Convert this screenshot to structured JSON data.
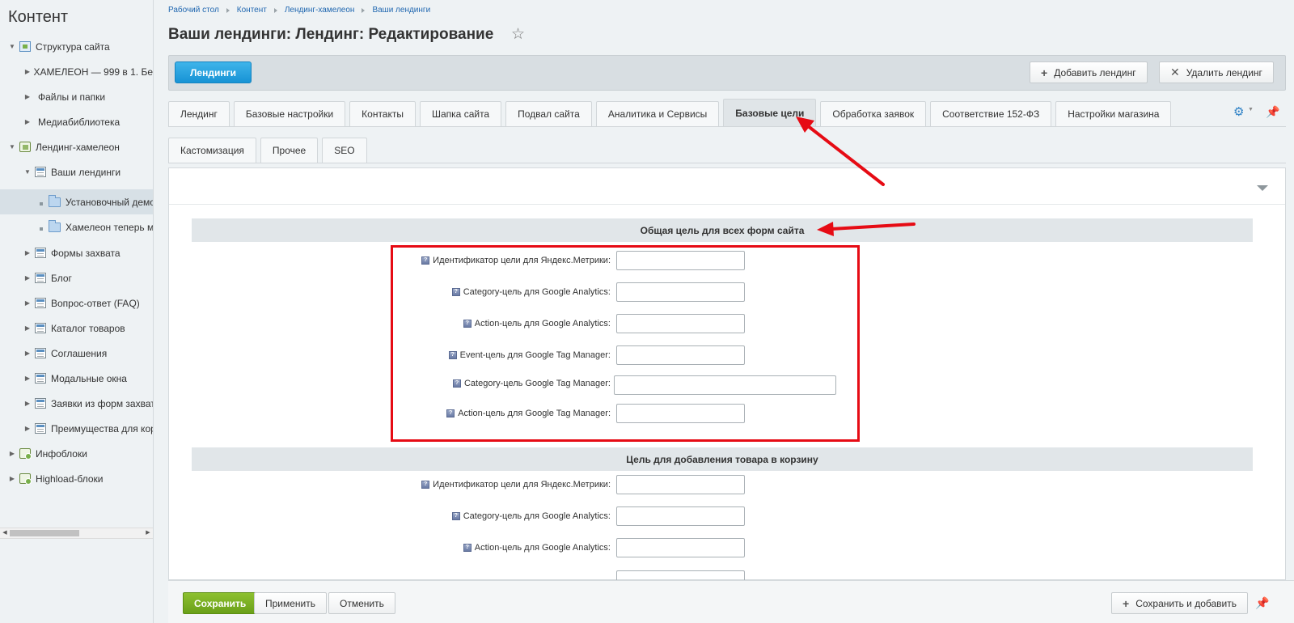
{
  "sidebar": {
    "title": "Контент",
    "items": [
      {
        "label": "Структура сайта"
      },
      {
        "label": "ХАМЕЛЕОН — 999 в 1. Бе"
      },
      {
        "label": "Файлы и папки"
      },
      {
        "label": "Медиабиблиотека"
      },
      {
        "label": "Лендинг-хамелеон"
      },
      {
        "label": "Ваши лендинги"
      },
      {
        "label": "Установочный демо"
      },
      {
        "label": "Хамелеон теперь м"
      },
      {
        "label": "Формы захвата"
      },
      {
        "label": "Блог"
      },
      {
        "label": "Вопрос-ответ (FAQ)"
      },
      {
        "label": "Каталог товаров"
      },
      {
        "label": "Соглашения"
      },
      {
        "label": "Модальные окна"
      },
      {
        "label": "Заявки из форм захват"
      },
      {
        "label": "Преимущества для кор"
      },
      {
        "label": "Инфоблоки"
      },
      {
        "label": "Highload-блоки"
      }
    ]
  },
  "breadcrumb": [
    "Рабочий стол",
    "Контент",
    "Лендинг-хамелеон",
    "Ваши лендинги"
  ],
  "page": {
    "title": "Ваши лендинги: Лендинг: Редактирование"
  },
  "toolbar": {
    "landings_label": "Лендинги",
    "add_label": "Добавить лендинг",
    "delete_label": "Удалить лендинг"
  },
  "tabs": [
    "Лендинг",
    "Базовые настройки",
    "Контакты",
    "Шапка сайта",
    "Подвал сайта",
    "Аналитика и Сервисы",
    "Базовые цели",
    "Обработка заявок",
    "Соответствие 152-ФЗ",
    "Настройки магазина"
  ],
  "active_tab": "Базовые цели",
  "subtabs": [
    "Кастомизация",
    "Прочее",
    "SEO"
  ],
  "sections": [
    {
      "title": "Общая цель для всех форм сайта",
      "fields": [
        {
          "label": "Идентификатор цели для Яндекс.Метрики:",
          "value": ""
        },
        {
          "label": "Category-цель для Google Analytics:",
          "value": ""
        },
        {
          "label": "Action-цель для Google Analytics:",
          "value": ""
        },
        {
          "label": "Event-цель для Google Tag Manager:",
          "value": ""
        },
        {
          "label": "Category-цель Google Tag Manager:",
          "value": ""
        },
        {
          "label": "Action-цель для Google Tag Manager:",
          "value": ""
        }
      ]
    },
    {
      "title": "Цель для добавления товара в корзину",
      "fields": [
        {
          "label": "Идентификатор цели для Яндекс.Метрики:",
          "value": ""
        },
        {
          "label": "Category-цель для Google Analytics:",
          "value": ""
        },
        {
          "label": "Action-цель для Google Analytics:",
          "value": ""
        }
      ]
    }
  ],
  "footer": {
    "save_label": "Сохранить",
    "apply_label": "Применить",
    "cancel_label": "Отменить",
    "save_add_label": "Сохранить и добавить"
  },
  "icons": {
    "star": "star-icon",
    "gear": "gear-icon",
    "pin": "pin-icon",
    "help": "help-icon",
    "plus": "plus-icon",
    "close": "close-icon"
  },
  "colors": {
    "accent_blue": "#1793d5",
    "save_green": "#6aa019",
    "annotation_red": "#e60b14",
    "link_blue": "#2067b0"
  }
}
